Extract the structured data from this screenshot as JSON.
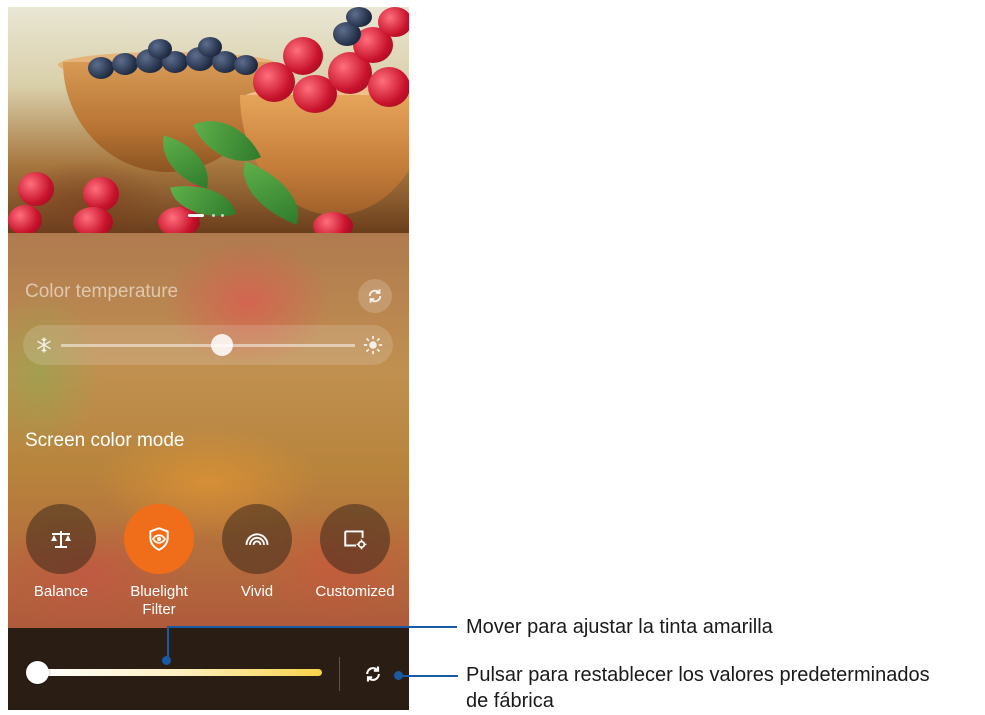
{
  "color_temperature": {
    "title": "Color temperature",
    "slider_value": 0.5
  },
  "screen_color_mode": {
    "title": "Screen color mode",
    "modes": [
      {
        "label": "Balance",
        "icon": "scale-icon",
        "active": false
      },
      {
        "label": "Bluelight\nFilter",
        "icon": "eye-shield-icon",
        "active": true
      },
      {
        "label": "Vivid",
        "icon": "rainbow-icon",
        "active": false
      },
      {
        "label": "Customized",
        "icon": "screen-settings-icon",
        "active": false
      }
    ]
  },
  "yellow_tint": {
    "slider_value": 0.0
  },
  "annotations": {
    "slider_note": "Mover para ajustar la tinta amarilla",
    "reset_note_line1": "Pulsar para restablecer los valores predeterminados",
    "reset_note_line2": "de fábrica"
  },
  "colors": {
    "accent_active": "#f06d1a",
    "callout": "#1a5aa5"
  }
}
